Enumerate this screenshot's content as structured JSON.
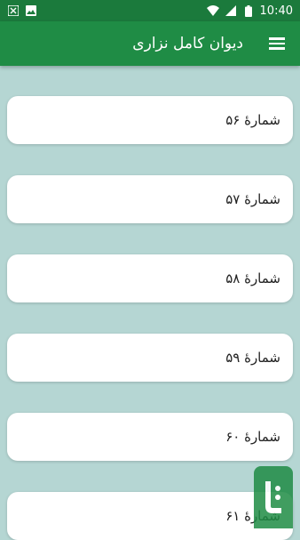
{
  "status_bar": {
    "time": "10:40",
    "icons": [
      "close-notification-icon",
      "image-notification-icon",
      "wifi-icon",
      "signal-icon",
      "battery-icon"
    ]
  },
  "app_bar": {
    "title": "دیوان کامل نزاری",
    "menu_icon": "hamburger-menu-icon"
  },
  "list": {
    "items": [
      {
        "label": "شمارهٔ ۵۶"
      },
      {
        "label": "شمارهٔ ۵۷"
      },
      {
        "label": "شمارهٔ ۵۸"
      },
      {
        "label": "شمارهٔ ۵۹"
      },
      {
        "label": "شمارهٔ ۶۰"
      },
      {
        "label": "شمارهٔ ۶۱"
      }
    ]
  },
  "colors": {
    "app_bar": "#1f8c45",
    "status_bar": "#1b7a3c",
    "background": "#b5d6d3",
    "card": "#ffffff"
  }
}
